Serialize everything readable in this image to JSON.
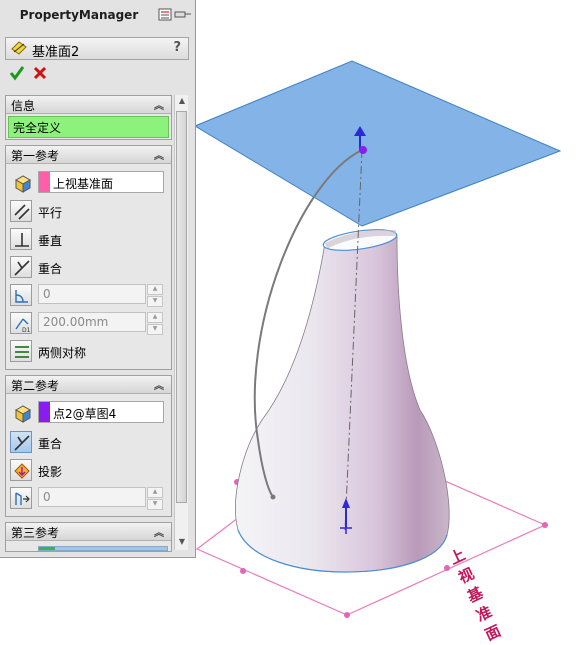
{
  "window": {
    "panel_title": "PropertyManager"
  },
  "feature": {
    "name": "基准面2",
    "help": "?"
  },
  "sections": {
    "info": {
      "title": "信息",
      "status": "完全定义"
    },
    "first_reference": {
      "title": "第一参考",
      "selection": "上视基准面",
      "selection_color": "#ff5fa8",
      "options": {
        "parallel": "平行",
        "perpendicular": "垂直",
        "coincident": "重合",
        "angle_value": "0",
        "offset_value": "200.00mm",
        "symmetric": "两侧对称"
      }
    },
    "second_reference": {
      "title": "第二参考",
      "selection": "点2@草图4",
      "selection_color": "#8a1cf0",
      "options": {
        "coincident": "重合",
        "project": "投影",
        "value": "0"
      }
    },
    "third_reference": {
      "title": "第三参考"
    }
  },
  "viewport": {
    "plane_label": "上视基准面",
    "plane_color": "#5b9bdf",
    "sketch_color": "#e87bbd",
    "status_color": "#8cf27c"
  }
}
